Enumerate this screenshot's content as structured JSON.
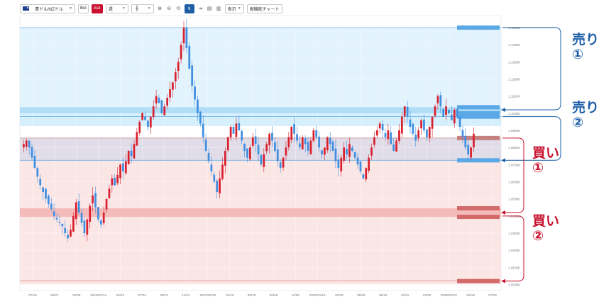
{
  "toolbar": {
    "pair": "豪ドル/NZドル",
    "bid_label": "Bid",
    "ask_label": "Ask",
    "timeframe": "週",
    "display_label": "表示",
    "advanced_label": "高機能チャート"
  },
  "chart_data": {
    "type": "candlestick",
    "y_ticks": [
      "1.15000",
      "1.14000",
      "1.13000",
      "1.12000",
      "1.11000",
      "1.10000",
      "1.09000",
      "1.08000",
      "1.07000",
      "1.06000",
      "1.05000",
      "1.04000",
      "1.03000",
      "1.02000",
      "1.01000",
      "1.00000"
    ],
    "x_ticks": [
      "07/19",
      "08/27",
      "12/05",
      "2022/03/14",
      "04/22",
      "07/04",
      "09/12",
      "11/21",
      "2023/01/30",
      "04/10",
      "06/19",
      "08/28",
      "11/06",
      "2024/01/15",
      "03/25",
      "06/03",
      "08/12",
      "10/21",
      "12/30",
      "2025/03/10",
      "05/19",
      "07/28"
    ],
    "ylim": [
      0.9965,
      1.157
    ],
    "colors": {
      "up": "#d9202e",
      "down": "#3f8ee0",
      "sell_zone": "#d6effc",
      "sell_band": "#a9d8f5",
      "buy_zone": "#fbe3e3",
      "buy_band": "#f2b3b3",
      "mid_zone": "#ddd9e5"
    },
    "zones": [
      {
        "type": "sell",
        "from": 1.0925,
        "to": 1.1015,
        "color": "#d6effc"
      },
      {
        "type": "sell",
        "from": 1.1015,
        "to": 1.15,
        "color": "#e2f3fd"
      },
      {
        "type": "mid",
        "from": 1.0725,
        "to": 1.0855,
        "color": "#e1dde8"
      },
      {
        "type": "buy",
        "from": 1.0,
        "to": 1.0725,
        "color": "#fbe6e6"
      }
    ],
    "levels": [
      {
        "type": "sell",
        "value": 1.15,
        "style": "line"
      },
      {
        "type": "sell",
        "value": 1.1035,
        "style": "band",
        "to": 1.1
      },
      {
        "type": "sell",
        "value": 1.098,
        "style": "line"
      },
      {
        "type": "mid",
        "value": 1.0855,
        "style": "line"
      },
      {
        "type": "sell",
        "value": 1.0725,
        "style": "line"
      },
      {
        "type": "buy",
        "value": 1.0445,
        "style": "band",
        "to": 1.0395
      },
      {
        "type": "buy",
        "value": 1.002,
        "style": "line"
      }
    ],
    "series_seed": [
      1.082,
      1.084,
      1.08,
      1.074,
      1.068,
      1.063,
      1.058,
      1.054,
      1.05,
      1.047,
      1.044,
      1.04,
      1.038,
      1.036,
      1.034,
      1.03,
      1.027,
      1.032,
      1.04,
      1.048,
      1.042,
      1.036,
      1.03,
      1.038,
      1.046,
      1.052,
      1.045,
      1.038,
      1.035,
      1.042,
      1.05,
      1.056,
      1.062,
      1.058,
      1.064,
      1.07,
      1.066,
      1.072,
      1.078,
      1.075,
      1.082,
      1.089,
      1.095,
      1.1,
      1.096,
      1.092,
      1.098,
      1.104,
      1.11,
      1.106,
      1.1,
      1.104,
      1.109,
      1.114,
      1.118,
      1.124,
      1.13,
      1.14,
      1.15,
      1.138,
      1.126,
      1.116,
      1.108,
      1.1,
      1.094,
      1.086,
      1.078,
      1.072,
      1.066,
      1.06,
      1.054,
      1.062,
      1.07,
      1.078,
      1.086,
      1.092,
      1.088,
      1.094,
      1.09,
      1.084,
      1.078,
      1.074,
      1.08,
      1.086,
      1.082,
      1.076,
      1.07,
      1.076,
      1.082,
      1.088,
      1.084,
      1.078,
      1.072,
      1.068,
      1.074,
      1.08,
      1.086,
      1.092,
      1.088,
      1.084,
      1.08,
      1.086,
      1.082,
      1.078,
      1.084,
      1.09,
      1.086,
      1.08,
      1.076,
      1.08,
      1.086,
      1.082,
      1.078,
      1.072,
      1.068,
      1.074,
      1.08,
      1.076,
      1.082,
      1.078,
      1.074,
      1.07,
      1.066,
      1.062,
      1.068,
      1.074,
      1.08,
      1.086,
      1.09,
      1.094,
      1.09,
      1.086,
      1.09,
      1.082,
      1.078,
      1.084,
      1.09,
      1.098,
      1.104,
      1.098,
      1.092,
      1.088,
      1.084,
      1.09,
      1.096,
      1.09,
      1.086,
      1.092,
      1.098,
      1.104,
      1.11,
      1.104,
      1.098,
      1.104,
      1.1,
      1.096,
      1.102,
      1.098,
      1.092,
      1.086,
      1.08,
      1.076,
      1.08,
      1.088
    ]
  },
  "annotations": {
    "sell1": "売り①",
    "sell2": "売り②",
    "buy1": "買い①",
    "buy2": "買い②"
  }
}
